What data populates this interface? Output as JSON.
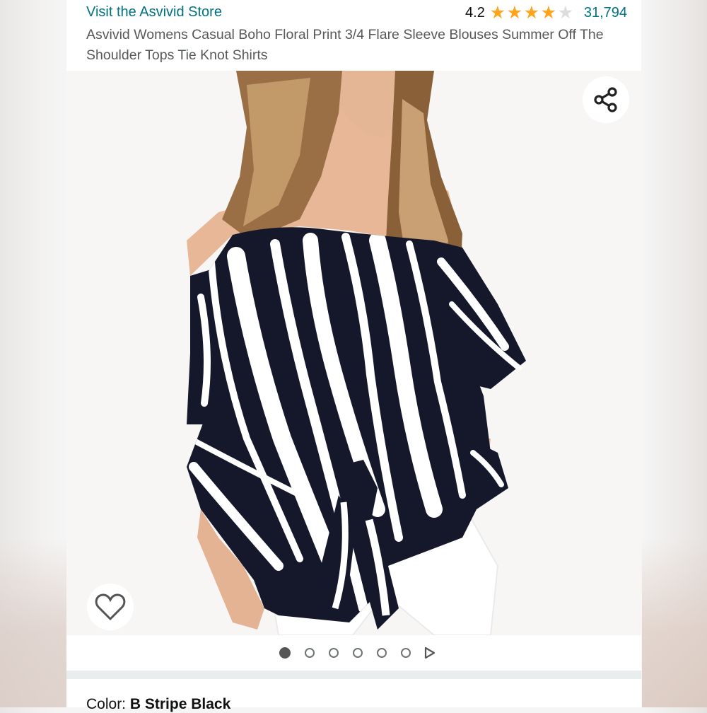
{
  "store": {
    "link_text": "Visit the Asvivid Store"
  },
  "rating": {
    "value": "4.2",
    "stars_filled": 4,
    "stars_total": 5,
    "count": "31,794"
  },
  "product": {
    "title": "Asvivid Womens Casual Boho Floral Print 3/4 Flare Sleeve Blouses Summer Off The Shoulder Tops Tie Knot Shirts",
    "image_alt": "Woman wearing black and white striped off-shoulder blouse with tie knot and white jeans"
  },
  "icons": {
    "share": "share-icon",
    "wishlist": "heart-icon",
    "video": "play-icon"
  },
  "carousel": {
    "image_count": 6,
    "active_index": 0,
    "has_video": true
  },
  "color": {
    "label": "Color:",
    "value": "B Stripe Black"
  },
  "colors": {
    "link": "#007185",
    "star": "#ffa41c",
    "text": "#0f1111",
    "secondary_text": "#565959"
  }
}
